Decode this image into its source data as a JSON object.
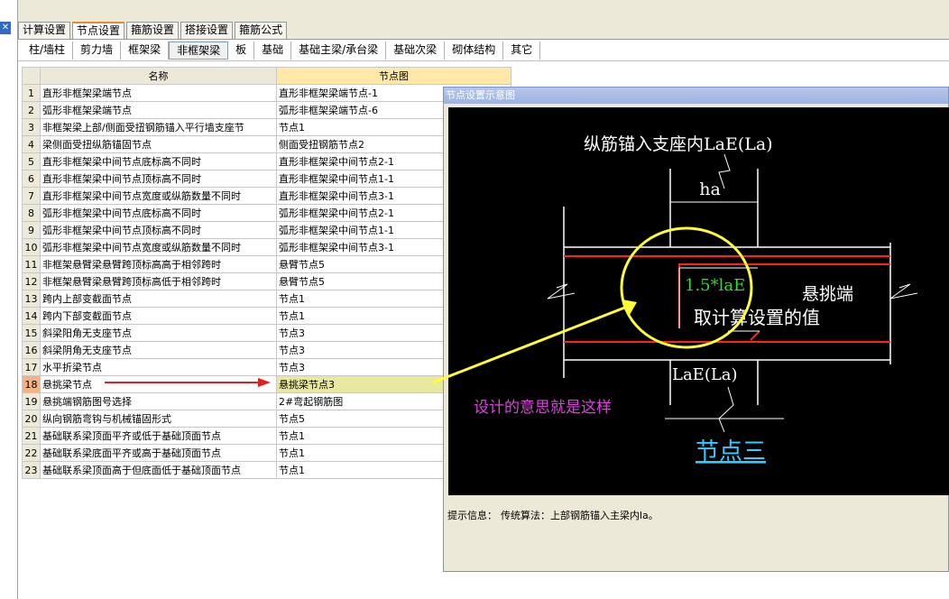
{
  "main_tabs": [
    "计算设置",
    "节点设置",
    "箍筋设置",
    "搭接设置",
    "箍筋公式"
  ],
  "main_tab_active": 1,
  "sub_tabs": [
    "柱/墙柱",
    "剪力墙",
    "框架梁",
    "非框架梁",
    "板",
    "基础",
    "基础主梁/承台梁",
    "基础次梁",
    "砌体结构",
    "其它"
  ],
  "sub_tab_active": 3,
  "table": {
    "headers": [
      "名称",
      "节点图"
    ],
    "rows": [
      {
        "no": "1",
        "name": "直形非框架梁端节点",
        "value": "直形非框架梁端节点-1"
      },
      {
        "no": "2",
        "name": "弧形非框架梁端节点",
        "value": "弧形非框架梁端节点-6"
      },
      {
        "no": "3",
        "name": "非框架梁上部/侧面受扭钢筋锚入平行墙支座节",
        "value": "节点1"
      },
      {
        "no": "4",
        "name": "梁侧面受扭纵筋锚固节点",
        "value": "侧面受扭钢筋节点2"
      },
      {
        "no": "5",
        "name": "直形非框架梁中间节点底标高不同时",
        "value": "直形非框架梁中间节点2-1"
      },
      {
        "no": "6",
        "name": "直形非框架梁中间节点顶标高不同时",
        "value": "直形非框架梁中间节点1-1"
      },
      {
        "no": "7",
        "name": "直形非框架梁中间节点宽度或纵筋数量不同时",
        "value": "直形非框架梁中间节点3-1"
      },
      {
        "no": "8",
        "name": "弧形非框架梁中间节点底标高不同时",
        "value": "弧形非框架梁中间节点2-1"
      },
      {
        "no": "9",
        "name": "弧形非框架梁中间节点顶标高不同时",
        "value": "弧形非框架梁中间节点1-1"
      },
      {
        "no": "10",
        "name": "弧形非框架梁中间节点宽度或纵筋数量不同时",
        "value": "弧形非框架梁中间节点3-1"
      },
      {
        "no": "11",
        "name": "非框架悬臂梁悬臂跨顶标高高于相邻跨时",
        "value": "悬臂节点5"
      },
      {
        "no": "12",
        "name": "非框架悬臂梁悬臂跨顶标高低于相邻跨时",
        "value": "悬臂节点5"
      },
      {
        "no": "13",
        "name": "跨内上部变截面节点",
        "value": "节点1"
      },
      {
        "no": "14",
        "name": "跨内下部变截面节点",
        "value": "节点1"
      },
      {
        "no": "15",
        "name": "斜梁阳角无支座节点",
        "value": "节点3"
      },
      {
        "no": "16",
        "name": "斜梁阴角无支座节点",
        "value": "节点3"
      },
      {
        "no": "17",
        "name": "水平折梁节点",
        "value": "节点3"
      },
      {
        "no": "18",
        "name": "悬挑梁节点",
        "value": "悬挑梁节点3"
      },
      {
        "no": "19",
        "name": "悬挑端钢筋图号选择",
        "value": "2#弯起钢筋图"
      },
      {
        "no": "20",
        "name": "纵向钢筋弯钩与机械锚固形式",
        "value": "节点5"
      },
      {
        "no": "21",
        "name": "基础联系梁顶面平齐或低于基础顶面节点",
        "value": "节点1"
      },
      {
        "no": "22",
        "name": "基础联系梁底面平齐或高于基础顶面节点",
        "value": "节点1"
      },
      {
        "no": "23",
        "name": "基础联系梁顶面高于但底面低于基础顶面节点",
        "value": "节点1"
      }
    ],
    "selected_row": 18
  },
  "dialog": {
    "title": "节点设置示意图",
    "drawing": {
      "top_label": "纵筋锚入支座内LaE(La)",
      "ha": "ha",
      "green_formula": "1.5*laE",
      "calc_text": "取计算设置的值",
      "cantilever": "悬挑端",
      "bottom_label": "LaE(La)",
      "node_name": "节点三"
    },
    "info_label": "提示信息：",
    "info_text": "传统算法：上部钢筋锚入主梁内la。"
  },
  "annotation": "设计的意思就是这样",
  "colors": {
    "annotation_arrow": "#ffff33",
    "red_arrow": "#e02020",
    "rebar": "#ff2020",
    "formula": "#33dd33",
    "node_name": "#33ccff"
  }
}
